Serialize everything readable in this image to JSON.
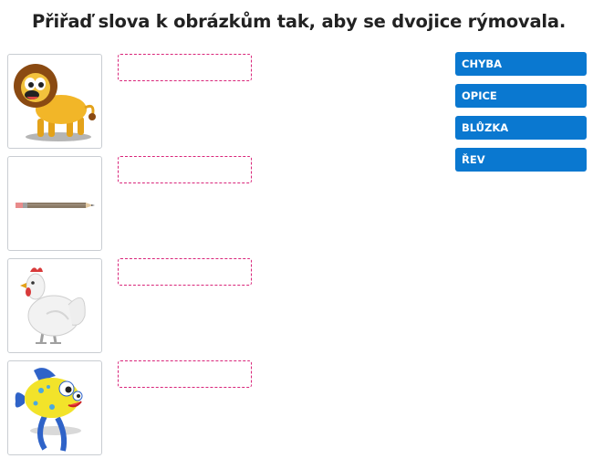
{
  "instruction": "Přiřaď slova k obrázkům tak, aby se dvojice rýmovala.",
  "pictures": [
    {
      "icon": "lion-icon",
      "slot_value": ""
    },
    {
      "icon": "pencil-icon",
      "slot_value": ""
    },
    {
      "icon": "hen-icon",
      "slot_value": ""
    },
    {
      "icon": "fish-icon",
      "slot_value": ""
    }
  ],
  "words": [
    "CHYBA",
    "OPICE",
    "BLŮZKA",
    "ŘEV"
  ],
  "colors": {
    "word_bg": "#0a78d0",
    "slot_border": "#d9257a",
    "picture_border": "#c9cdd2"
  }
}
